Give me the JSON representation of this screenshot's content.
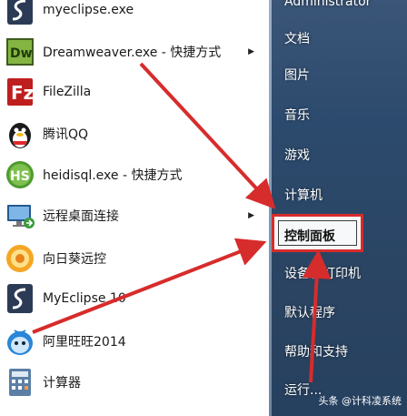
{
  "programs": [
    {
      "label": "myeclipse.exe",
      "icon": "myeclipse-icon",
      "submenu": false
    },
    {
      "label": "Dreamweaver.exe - 快捷方式",
      "icon": "dreamweaver-icon",
      "submenu": true
    },
    {
      "label": "FileZilla",
      "icon": "filezilla-icon",
      "submenu": false
    },
    {
      "label": "腾讯QQ",
      "icon": "qq-icon",
      "submenu": false
    },
    {
      "label": "heidisql.exe - 快捷方式",
      "icon": "heidisql-icon",
      "submenu": false
    },
    {
      "label": "远程桌面连接",
      "icon": "remote-desktop-icon",
      "submenu": true
    },
    {
      "label": "向日葵远控",
      "icon": "sunflower-icon",
      "submenu": false
    },
    {
      "label": "MyEclipse 10",
      "icon": "myeclipse-icon",
      "submenu": false
    },
    {
      "label": "阿里旺旺2014",
      "icon": "aliwangwang-icon",
      "submenu": false
    },
    {
      "label": "计算器",
      "icon": "calculator-icon",
      "submenu": false
    }
  ],
  "right_menu": {
    "user": "Administrator",
    "documents": "文档",
    "pictures": "图片",
    "music": "音乐",
    "games": "游戏",
    "computer": "计算机",
    "control_panel": "控制面板",
    "devices_printers": "设备和打印机",
    "default_programs": "默认程序",
    "help_support": "帮助和支持",
    "run": "运行..."
  },
  "watermark": "头条 @计科凌系统",
  "colors": {
    "annotation": "#d72c2c",
    "right_panel": "#2c4a6d"
  }
}
